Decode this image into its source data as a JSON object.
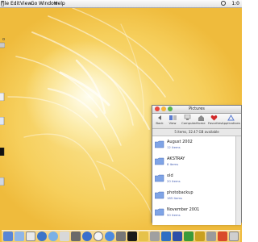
{
  "menubar": {
    "items": [
      "File",
      "Edit",
      "View",
      "Go",
      "Window",
      "Help"
    ],
    "time": "1:0"
  },
  "desktop_icons": [
    {
      "name": "hard-drive-icon",
      "label": "o"
    },
    {
      "name": "document-icon",
      "label": ""
    },
    {
      "name": "document-icon",
      "label": ""
    },
    {
      "name": "document-icon",
      "label": ""
    },
    {
      "name": "document-icon",
      "label": ""
    }
  ],
  "finder": {
    "title": "Pictures",
    "toolbar": [
      "Back",
      "View",
      "Computer",
      "Home",
      "Favorites",
      "Applications"
    ],
    "status": "5 items, 32.47 GB available",
    "items": [
      {
        "name": "August 2002",
        "info": "12 items"
      },
      {
        "name": "AKSTRAY",
        "info": "8 items"
      },
      {
        "name": "old",
        "info": "20 items"
      },
      {
        "name": "photobackup",
        "info": "185 items"
      },
      {
        "name": "November 2001",
        "info": "50 items"
      }
    ]
  },
  "dock": {
    "icons": [
      "finder-icon",
      "mail-icon",
      "ichat-icon",
      "ie-icon",
      "itunes-icon",
      "iphoto-icon",
      "imovie-icon",
      "quicktime-icon",
      "clock-icon",
      "safari-icon",
      "preferences-icon",
      "terminal-icon",
      "folder-icon",
      "folder-icon",
      "photoshop-icon",
      "word-icon",
      "excel-icon",
      "music-icon",
      "app-icon",
      "app-icon",
      "trash-icon"
    ]
  },
  "colors": {
    "accent_blue": "#4a63b4",
    "desktop_gold": "#f6cf5c",
    "close": "#e8473c",
    "minimize": "#f5b43a",
    "zoom": "#5bb24a"
  }
}
